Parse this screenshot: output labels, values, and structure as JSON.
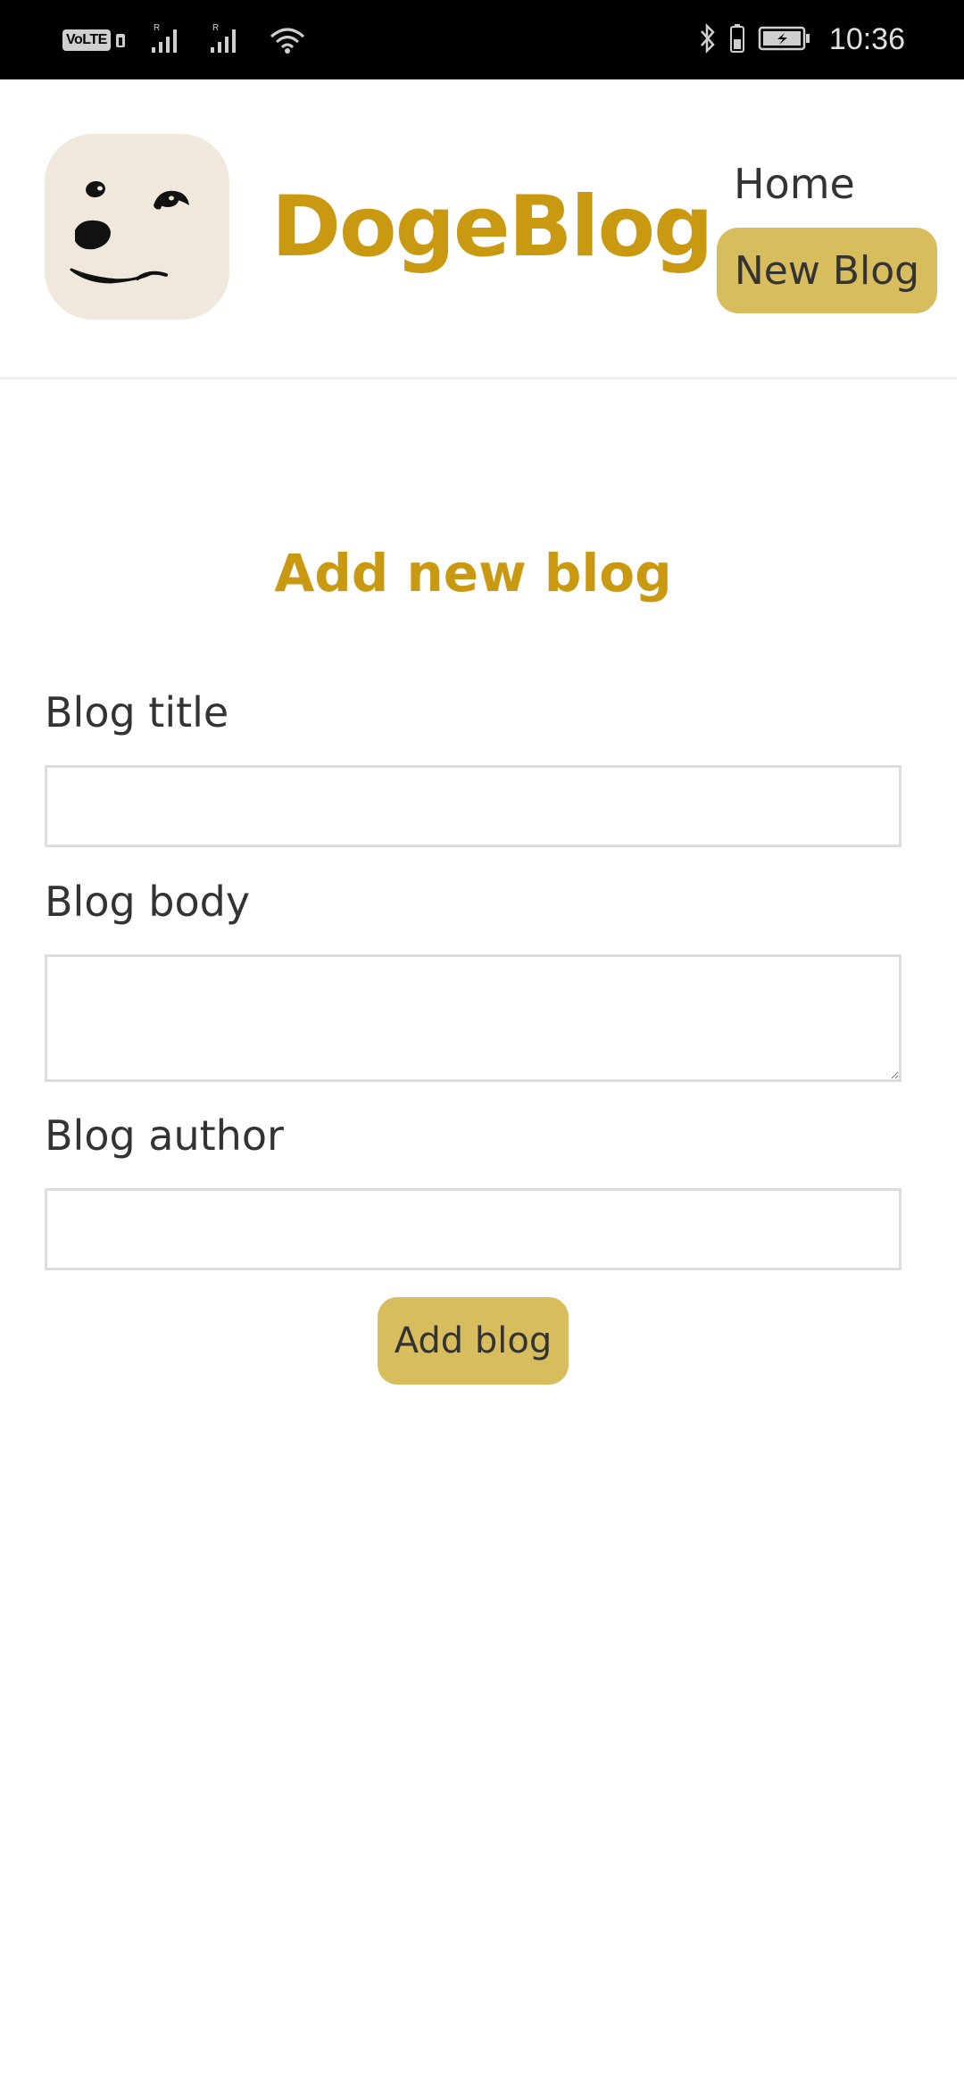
{
  "status_bar": {
    "network_badge": "VoLTE",
    "time": "10:36",
    "icons": [
      "volte-icon",
      "signal-icon",
      "signal-icon",
      "wifi-icon",
      "bluetooth-icon",
      "battery-icon",
      "battery-charging-icon"
    ]
  },
  "header": {
    "brand": "DogeBlog",
    "logo_icon": "doge-logo-icon",
    "nav": {
      "home_label": "Home",
      "new_blog_label": "New Blog"
    }
  },
  "form": {
    "title": "Add new blog",
    "title_label": "Blog title",
    "title_value": "",
    "body_label": "Blog body",
    "body_value": "",
    "author_label": "Blog author",
    "author_value": "",
    "submit_label": "Add blog"
  },
  "colors": {
    "brand": "#c99a11",
    "button": "#d8bd5e",
    "logo_background": "#f0e8dd",
    "text": "#333333",
    "status_bar": "#000000"
  }
}
